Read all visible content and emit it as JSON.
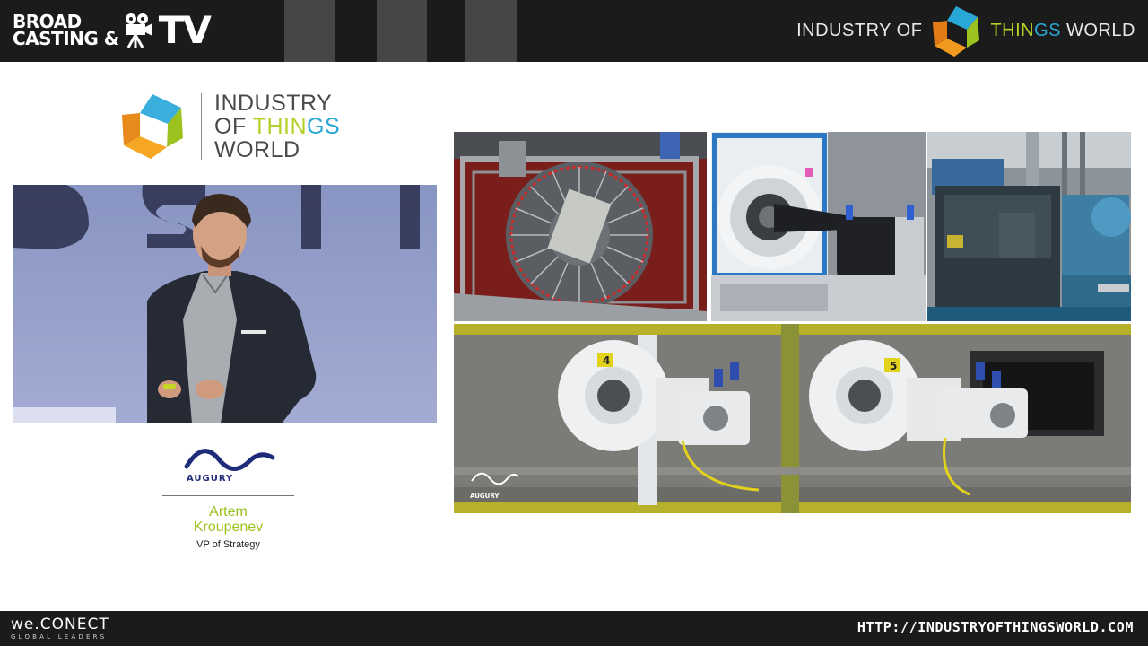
{
  "broadcast": {
    "line1": "BROAD",
    "line2": "CASTING &",
    "tv": "TV"
  },
  "top_right": {
    "prefix": "INDUSTRY OF",
    "things_a": "THIN",
    "things_b": "GS",
    "suffix": "WORLD"
  },
  "event_logo": {
    "line1": "INDUSTRY",
    "line2_a": "OF ",
    "line2_b": "THIN",
    "line2_c": "GS",
    "line3": "WORLD"
  },
  "speaker": {
    "company_logo_text": "AUGURY",
    "name_line1": "Artem",
    "name_line2": "Kroupenev",
    "title": "VP of Strategy"
  },
  "slide": {
    "motor_labels": [
      "4",
      "5"
    ],
    "watermark": "AUGURY"
  },
  "footer": {
    "brand": "we.CONECT",
    "tagline": "GLOBAL LEADERS",
    "url": "HTTP://INDUSTRYOFTHINGSWORLD.COM"
  },
  "colors": {
    "bar_dark": "#1b1b1b",
    "things_green": "#b8cf2a",
    "things_blue": "#29a8d8",
    "speaker_green": "#9cc220",
    "augury_navy": "#1f2c7a",
    "frame_yellow": "#b7b02a"
  }
}
